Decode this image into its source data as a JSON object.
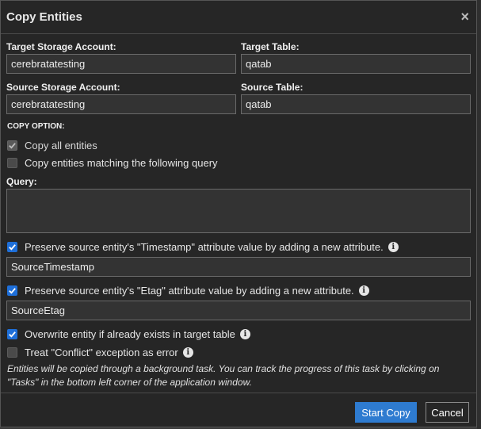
{
  "dialog": {
    "title": "Copy Entities",
    "close_symbol": "×"
  },
  "target": {
    "account_label": "Target Storage Account:",
    "account_value": "cerebratatesting",
    "table_label": "Target Table:",
    "table_value": "qatab"
  },
  "source": {
    "account_label": "Source Storage Account:",
    "account_value": "cerebratatesting",
    "table_label": "Source Table:",
    "table_value": "qatab"
  },
  "copy_option": {
    "title": "COPY OPTION:",
    "all_label": "Copy all entities",
    "all_checked": true,
    "query_label": "Copy entities matching the following query",
    "query_checked": false
  },
  "query": {
    "label": "Query:",
    "value": ""
  },
  "timestamp": {
    "label": "Preserve source entity's \"Timestamp\" attribute value by adding a new attribute.",
    "checked": true,
    "value": "SourceTimestamp"
  },
  "etag": {
    "label": "Preserve source entity's \"Etag\" attribute value by adding a new attribute.",
    "checked": true,
    "value": "SourceEtag"
  },
  "overwrite": {
    "label": "Overwrite entity if already exists in target table",
    "checked": true
  },
  "conflict": {
    "label": "Treat \"Conflict\" exception as error",
    "checked": false
  },
  "info_glyph": "i",
  "note": "Entities will be copied through a background task. You can track the progress of this task by clicking on \"Tasks\" in the bottom left corner of the application window.",
  "buttons": {
    "start": "Start Copy",
    "cancel": "Cancel"
  },
  "colors": {
    "accent": "#2e7bd0",
    "checkbox_on": "#1e6fd9",
    "background": "#262626"
  },
  "icons": {
    "close": "close-icon",
    "info": "info-icon",
    "check": "checkmark-icon"
  }
}
